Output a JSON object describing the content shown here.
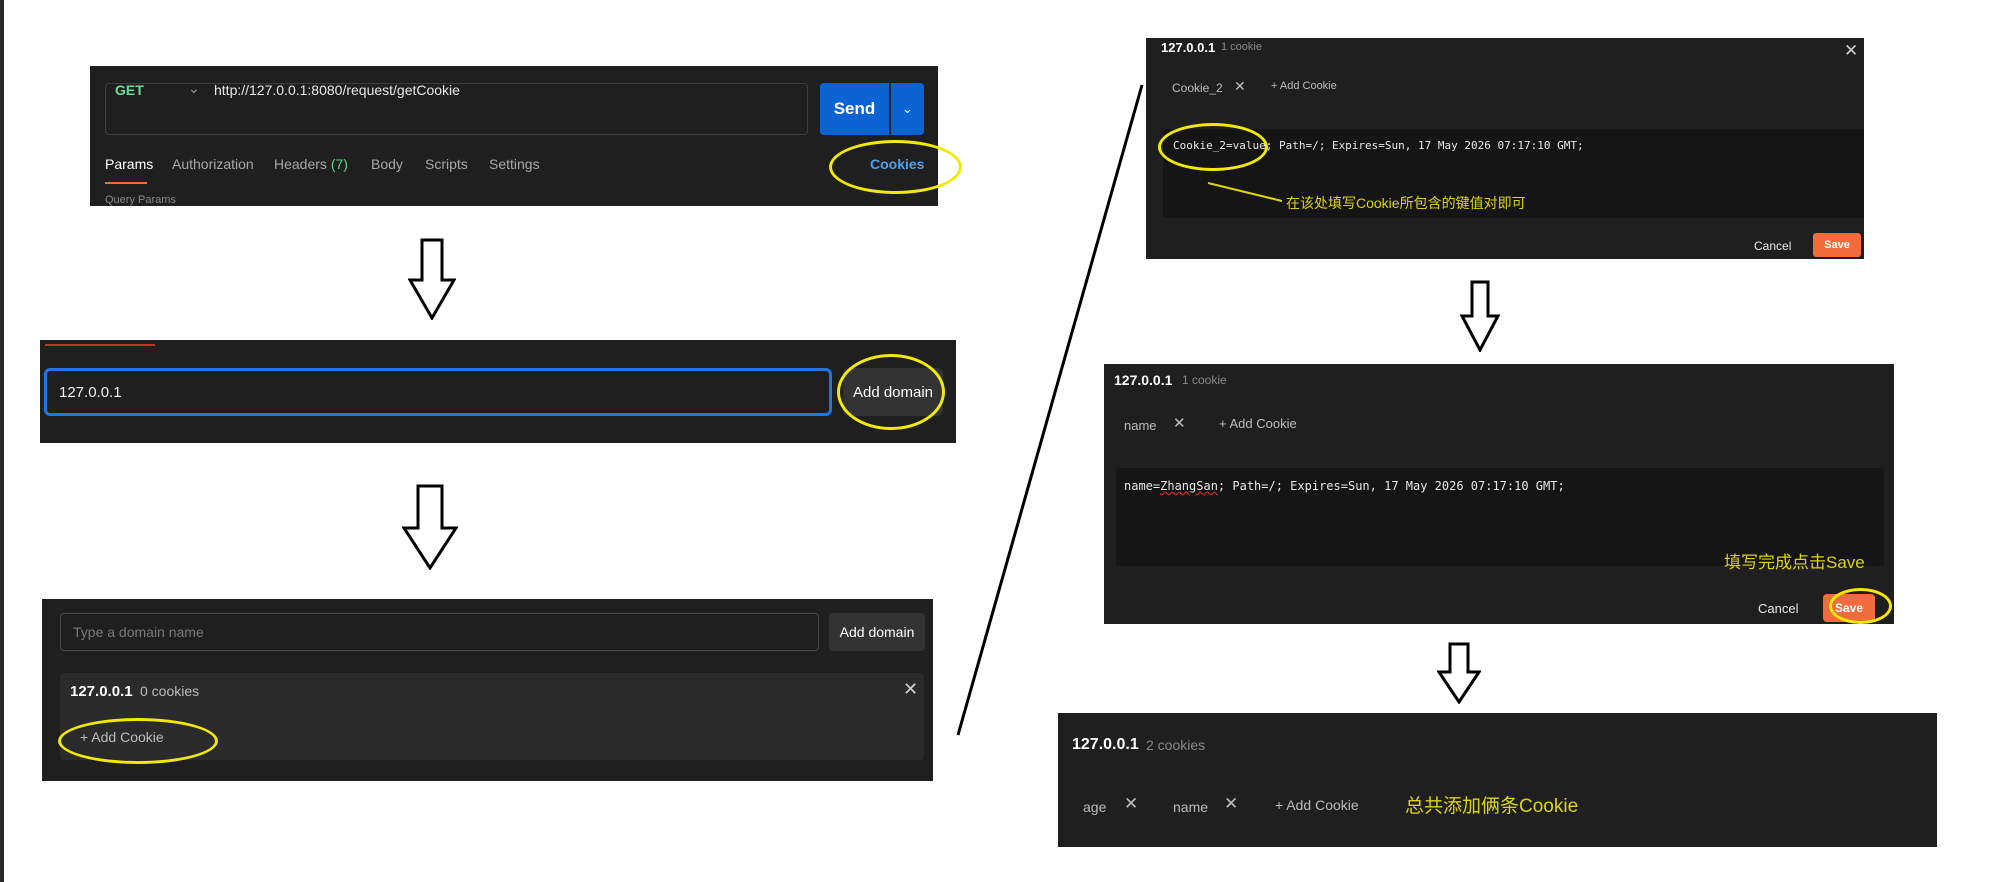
{
  "request_panel": {
    "method": "GET",
    "method_chevron": "⌄",
    "url": "http://127.0.0.1:8080/request/getCookie",
    "send_label": "Send",
    "send_chevron": "⌄",
    "tabs": [
      {
        "label": "Params",
        "active": true
      },
      {
        "label": "Authorization",
        "active": false
      },
      {
        "label": "Headers",
        "count": "(7)",
        "active": false
      },
      {
        "label": "Body",
        "active": false
      },
      {
        "label": "Scripts",
        "active": false
      },
      {
        "label": "Settings",
        "active": false
      }
    ],
    "cookies_link": "Cookies",
    "section_subtitle": "Query Params"
  },
  "domain_input_panel": {
    "input_value": "127.0.0.1",
    "add_domain_label": "Add domain"
  },
  "domain_list_panel": {
    "input_placeholder": "Type a domain name",
    "add_domain_label": "Add domain",
    "domain": "127.0.0.1",
    "cookie_count": "0 cookies",
    "close_glyph": "✕",
    "add_cookie_label": "+ Add Cookie"
  },
  "cookie_edit_panel": {
    "domain": "127.0.0.1",
    "cookie_count": "1 cookie",
    "close_glyph": "✕",
    "chip_label": "Cookie_2",
    "chip_close": "✕",
    "add_cookie_label": "+ Add Cookie",
    "cookie_text": "Cookie_2=value; Path=/; Expires=Sun, 17 May 2026 07:17:10 GMT;",
    "annotation": "在该处填写Cookie所包含的键值对即可",
    "cancel_label": "Cancel",
    "save_label": "Save"
  },
  "cookie_filled_panel": {
    "domain": "127.0.0.1",
    "cookie_count": "1 cookie",
    "chip_label": "name",
    "chip_close": "✕",
    "add_cookie_label": "+ Add Cookie",
    "cookie_text_prefix": "name=",
    "cookie_text_value": "ZhangSan",
    "cookie_text_suffix": "; Path=/; Expires=Sun, 17 May 2026 07:17:10 GMT;",
    "annotation": "填写完成点击Save",
    "cancel_label": "Cancel",
    "save_label": "Save"
  },
  "cookie_result_panel": {
    "domain": "127.0.0.1",
    "cookie_count": "2 cookies",
    "chips": [
      {
        "label": "age",
        "close": "✕"
      },
      {
        "label": "name",
        "close": "✕"
      }
    ],
    "add_cookie_label": "+ Add Cookie",
    "annotation": "总共添加俩条Cookie"
  },
  "colors": {
    "panel_bg": "#1f1f1f",
    "highlight": "#f2ea06",
    "send_blue": "#0c63d4",
    "save_orange": "#f26b3a",
    "annotation_yellow": "#ddd40c",
    "method_green": "#6bdd9a",
    "cookies_link_blue": "#4aa2f0"
  },
  "icons": {
    "flow_arrow": "down-arrow-icon",
    "close": "close-icon",
    "chevron": "chevron-down-icon"
  }
}
